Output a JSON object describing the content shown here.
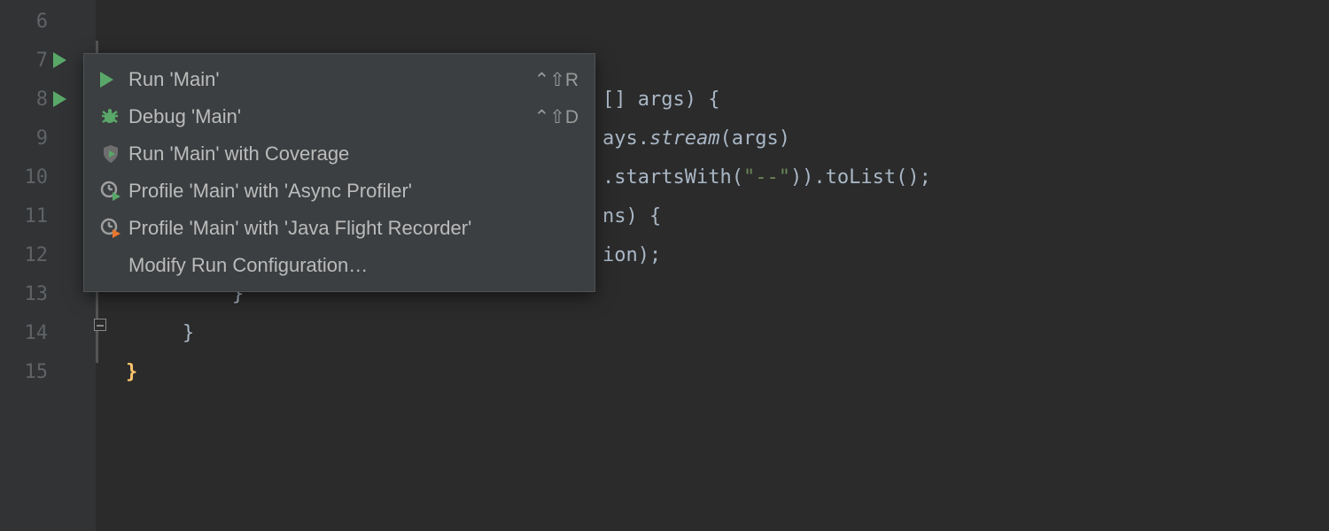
{
  "gutter": {
    "lines": [
      "6",
      "7",
      "8",
      "9",
      "10",
      "11",
      "12",
      "13",
      "14",
      "15"
    ]
  },
  "code": {
    "line8_tail": "[] args) {",
    "line9_a": "ays.",
    "line9_b": "stream",
    "line9_c": "(args)",
    "line10_a": ".startsWith(",
    "line10_str": "\"--\"",
    "line10_b": ")).toList();",
    "line11": "ns) {",
    "line12": "ion);",
    "line13": "}",
    "line14": "}",
    "line15": "}"
  },
  "menu": {
    "items": [
      {
        "label": "Run 'Main'",
        "shortcut": "⌃⇧R"
      },
      {
        "label": "Debug 'Main'",
        "shortcut": "⌃⇧D"
      },
      {
        "label": "Run 'Main' with Coverage",
        "shortcut": ""
      },
      {
        "label": "Profile 'Main' with 'Async Profiler'",
        "shortcut": ""
      },
      {
        "label": "Profile 'Main' with 'Java Flight Recorder'",
        "shortcut": ""
      },
      {
        "label": "Modify Run Configuration…",
        "shortcut": ""
      }
    ]
  }
}
